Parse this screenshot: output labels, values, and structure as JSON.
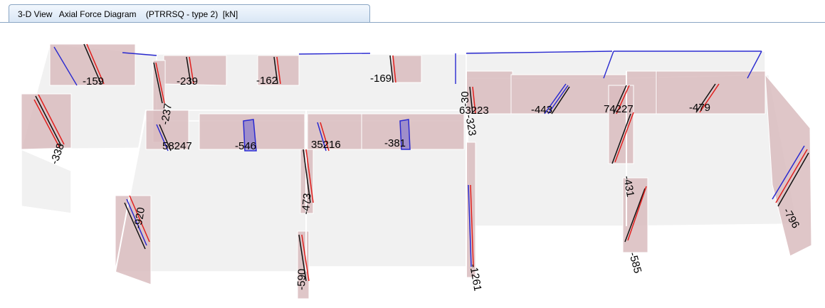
{
  "tab": {
    "title": "3-D View   Axial Force Diagram    (PTRRSQ - type 2)  [kN]"
  },
  "colors": {
    "wall_face": "#f1f1f1",
    "force_fill": "#d9bcbe",
    "force_line_red": "#e0201e",
    "force_line_black": "#111111",
    "force_line_blue": "#2a2ad0"
  },
  "labels": [
    {
      "id": "l1",
      "text": "-159"
    },
    {
      "id": "l2",
      "text": "-239"
    },
    {
      "id": "l3",
      "text": "-162"
    },
    {
      "id": "l4",
      "text": "-169"
    },
    {
      "id": "l5",
      "text": "-338"
    },
    {
      "id": "l6",
      "text": "-237"
    },
    {
      "id": "l7",
      "text": "58247"
    },
    {
      "id": "l8",
      "text": "-546"
    },
    {
      "id": "l9",
      "text": "35216"
    },
    {
      "id": "l10",
      "text": "-381"
    },
    {
      "id": "l11",
      "text": "-30"
    },
    {
      "id": "l12",
      "text": "-323"
    },
    {
      "id": "l13",
      "text": "63223"
    },
    {
      "id": "l14",
      "text": "-443"
    },
    {
      "id": "l15",
      "text": "74227"
    },
    {
      "id": "l16",
      "text": "-479"
    },
    {
      "id": "l17",
      "text": "-920"
    },
    {
      "id": "l18",
      "text": "-473"
    },
    {
      "id": "l19",
      "text": "-590"
    },
    {
      "id": "l20",
      "text": "-1261"
    },
    {
      "id": "l21",
      "text": "-431"
    },
    {
      "id": "l22",
      "text": "-585"
    },
    {
      "id": "l23",
      "text": "-796"
    }
  ]
}
